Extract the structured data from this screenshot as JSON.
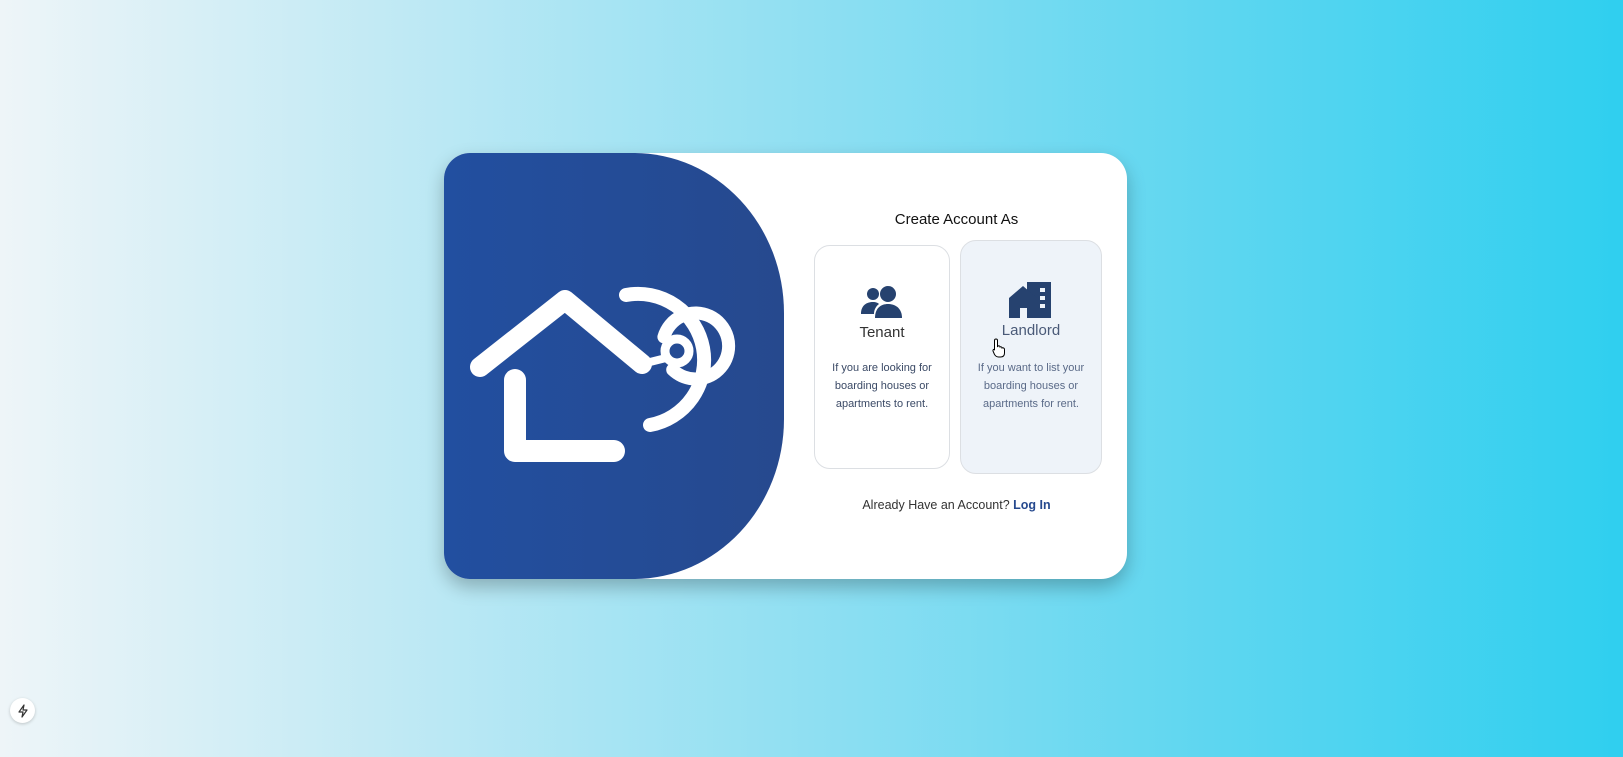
{
  "signup": {
    "title": "Create Account As",
    "options": [
      {
        "label": "Tenant",
        "description": "If you are looking for boarding houses or apartments to rent.",
        "icon": "users-icon"
      },
      {
        "label": "Landlord",
        "description": "If you want to list your boarding houses or apartments for rent.",
        "icon": "house-building-icon"
      }
    ],
    "footer_text": "Already Have an Account?",
    "login_link": "Log In"
  },
  "colors": {
    "brand": "#224fa0",
    "icon": "#26426f",
    "selected_bg": "#eef3f9"
  }
}
